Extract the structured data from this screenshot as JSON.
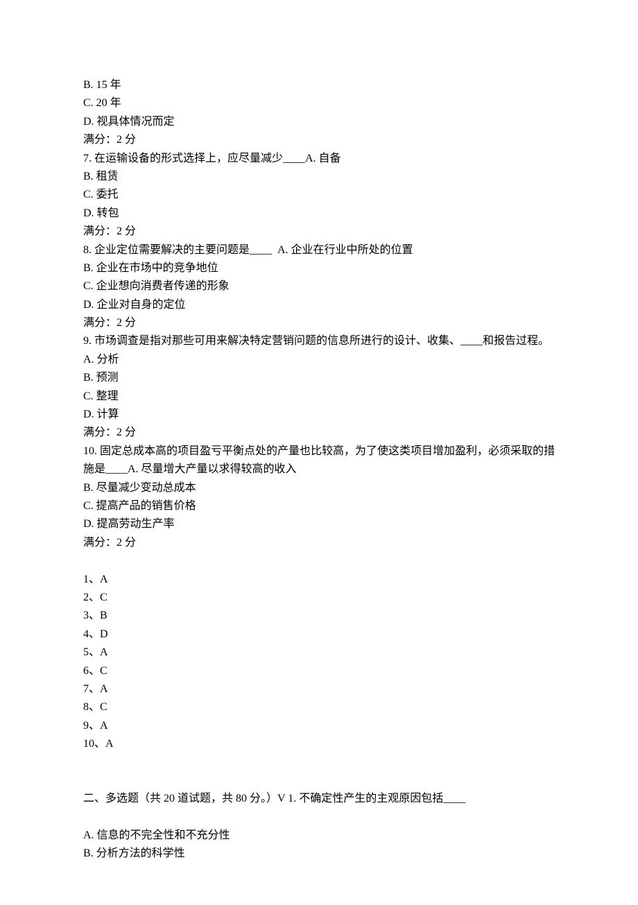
{
  "q6": {
    "optB": "B. 15 年",
    "optC": "C. 20 年",
    "optD": "D. 视具体情况而定",
    "score": "满分：2 分"
  },
  "q7": {
    "stem": "7. 在运输设备的形式选择上，应尽量减少____A. 自备",
    "optB": "B. 租赁",
    "optC": "C. 委托",
    "optD": "D. 转包",
    "score": "满分：2 分"
  },
  "q8": {
    "stem": "8. 企业定位需要解决的主要问题是____  A. 企业在行业中所处的位置",
    "optB": "B. 企业在市场中的竞争地位",
    "optC": "C. 企业想向消费者传递的形象",
    "optD": "D. 企业对自身的定位",
    "score": "满分：2 分"
  },
  "q9": {
    "stem": "9. 市场调查是指对那些可用来解决特定营销问题的信息所进行的设计、收集、____和报告过程。A. 分析",
    "optB": "B. 预测",
    "optC": "C. 整理",
    "optD": "D. 计算",
    "score": "满分：2 分"
  },
  "q10": {
    "stem": "10. 固定总成本高的项目盈亏平衡点处的产量也比较高，为了使这类项目增加盈利，必须采取的措施是____A. 尽量增大产量以求得较高的收入",
    "optB": "B. 尽量减少变动总成本",
    "optC": "C. 提高产品的销售价格",
    "optD": "D. 提高劳动生产率",
    "score": "满分：2 分"
  },
  "answers": {
    "a1": "1、A",
    "a2": "2、C",
    "a3": "3、B",
    "a4": "4、D",
    "a5": "5、A",
    "a6": "6、C",
    "a7": "7、A",
    "a8": "8、C",
    "a9": "9、A",
    "a10": "10、A"
  },
  "section2": {
    "heading": "二、多选题（共 20 道试题，共 80 分。）V 1. 不确定性产生的主观原因包括____",
    "optA": "A. 信息的不完全性和不充分性",
    "optB": "B. 分析方法的科学性"
  }
}
